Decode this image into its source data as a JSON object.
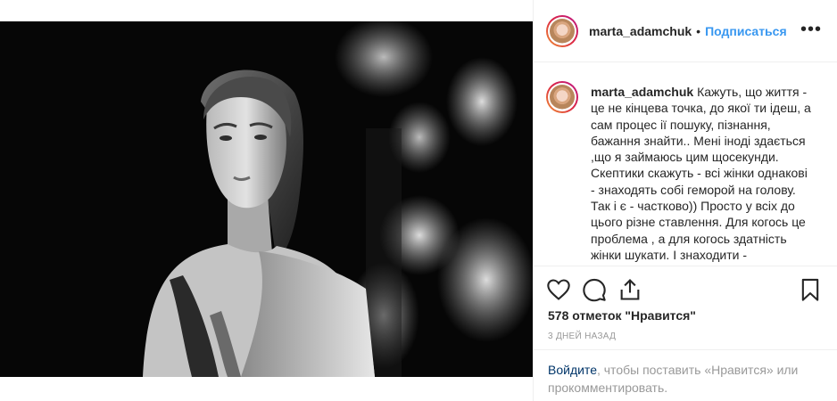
{
  "post": {
    "username": "marta_adamchuk",
    "separator": "•",
    "follow_label": "Подписаться",
    "more_icon": "more-options-icon",
    "caption_text": "Кажуть, що життя - це не кінцева точка, до якої ти ідеш, а сам процес ії пошуку, пізнання, бажання знайти.. Мені іноді здається ,що я займаюсь цим щосекунди. Скептики скажуть - всі жінки однакові - знаходять собі геморой на голову. Так і є - частково)) Просто у всіх до цього різне ставлення. Для когось це проблема , а для когось здатність жінки шукати. І знаходити -",
    "likes_text": "578 отметок \"Нравится\"",
    "date_text": "3 дней назад",
    "login_link": "Войдите",
    "login_rest": ", чтобы поставить «Нравится» или прокомментировать."
  },
  "icons": {
    "like": "heart-icon",
    "comment": "comment-icon",
    "share": "share-icon",
    "save": "bookmark-icon"
  },
  "colors": {
    "link_blue": "#3897f0",
    "text": "#262626",
    "muted": "#999999",
    "login_link": "#003569"
  }
}
